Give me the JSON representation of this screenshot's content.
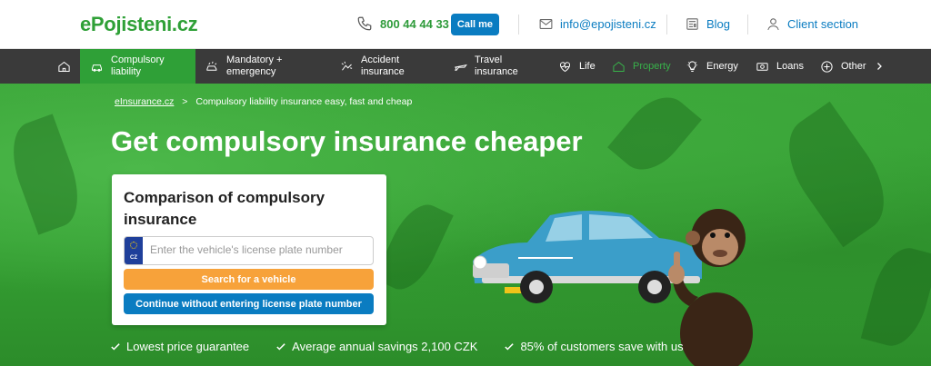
{
  "header": {
    "logo": "ePojisteni.cz",
    "phone": "800 44 44 33",
    "call_label": "Call me",
    "email": "info@epojisteni.cz",
    "blog": "Blog",
    "client": "Client section"
  },
  "nav": {
    "items": [
      {
        "label": "Compulsory liability",
        "line1": "Compulsory",
        "line2": "liability"
      },
      {
        "label": "Mandatory + emergency",
        "line1": "Mandatory +",
        "line2": "emergency"
      },
      {
        "label": "Accident insurance",
        "line1": "Accident",
        "line2": "insurance"
      },
      {
        "label": "Travel insurance",
        "line1": "Travel",
        "line2": "insurance"
      },
      {
        "label": "Life"
      },
      {
        "label": "Property"
      },
      {
        "label": "Energy"
      },
      {
        "label": "Loans"
      },
      {
        "label": "Other"
      }
    ]
  },
  "breadcrumb": {
    "home": "eInsurance.cz",
    "sep": ">",
    "current": "Compulsory liability insurance easy, fast and cheap"
  },
  "hero": {
    "title": "Get compulsory insurance cheaper"
  },
  "form": {
    "title": "Comparison of compulsory insurance",
    "plate_code": "CZ",
    "plate_placeholder": "Enter the vehicle's license plate number",
    "search_label": "Search for a vehicle",
    "continue_label": "Continue without entering license plate number"
  },
  "benefits": [
    "Lowest price guarantee",
    "Average annual savings 2,100 CZK",
    "85% of customers save with us"
  ],
  "colors": {
    "brand_green": "#2fa037",
    "brand_blue": "#0a7cc1",
    "orange": "#f7a23a",
    "nav_bg": "#3a3a3a"
  }
}
